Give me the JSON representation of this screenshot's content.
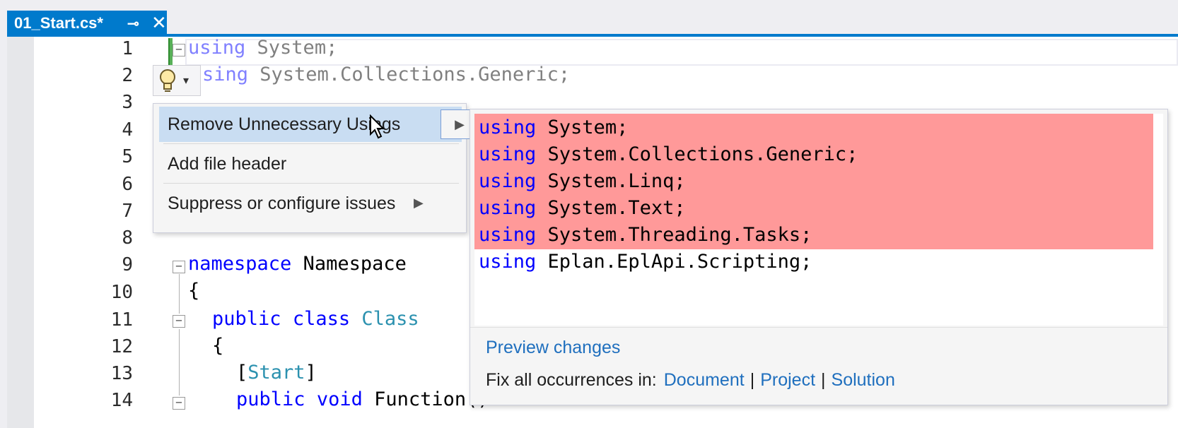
{
  "tab": {
    "title": "01_Start.cs*",
    "pin_glyph": "⊸",
    "close_glyph": "✕"
  },
  "line_numbers": [
    "1",
    "2",
    "3",
    "4",
    "5",
    "6",
    "7",
    "8",
    "9",
    "10",
    "11",
    "12",
    "13",
    "14"
  ],
  "code": {
    "line1_kw": "using",
    "line1_rest": " System;",
    "line2_kw": "sing",
    "line2_rest": " System.Collections.Generic;",
    "line9_kw": "namespace",
    "line9_rest": " Namespace",
    "line10": "{",
    "line11_kw1": "public",
    "line11_kw2": "class",
    "line11_type": "Class",
    "line12": "{",
    "line13_open": "[",
    "line13_type": "Start",
    "line13_close": "]",
    "line14_kw1": "public",
    "line14_kw2": "void",
    "line14_rest": " Function()"
  },
  "lightbulb": {
    "icon": "lightbulb-icon",
    "caret": "▾"
  },
  "menu": {
    "items": [
      {
        "label": "Remove Unnecessary Usings",
        "selected": true,
        "has_submenu": true
      },
      {
        "label": "Add file header",
        "selected": false,
        "has_submenu": false
      },
      {
        "label": "Suppress or configure issues",
        "selected": false,
        "has_submenu": true
      }
    ],
    "submenu_glyph": "▶"
  },
  "preview": {
    "lines": [
      {
        "kw": "using",
        "rest": " System;",
        "removed": true
      },
      {
        "kw": "using",
        "rest": " System.Collections.Generic;",
        "removed": true
      },
      {
        "kw": "using",
        "rest": " System.Linq;",
        "removed": true
      },
      {
        "kw": "using",
        "rest": " System.Text;",
        "removed": true
      },
      {
        "kw": "using",
        "rest": " System.Threading.Tasks;",
        "removed": true
      },
      {
        "kw": "using",
        "rest": " Eplan.EplApi.Scripting;",
        "removed": false
      }
    ],
    "preview_link": "Preview changes",
    "fix_all_label": "Fix all occurrences in:",
    "scopes": [
      "Document",
      "Project",
      "Solution"
    ],
    "scope_separator": "|"
  },
  "colors": {
    "accent": "#007acc",
    "removed_bg": "#ff9999",
    "keyword": "#0000ff",
    "type": "#2b91af",
    "link": "#1f6fbe"
  }
}
